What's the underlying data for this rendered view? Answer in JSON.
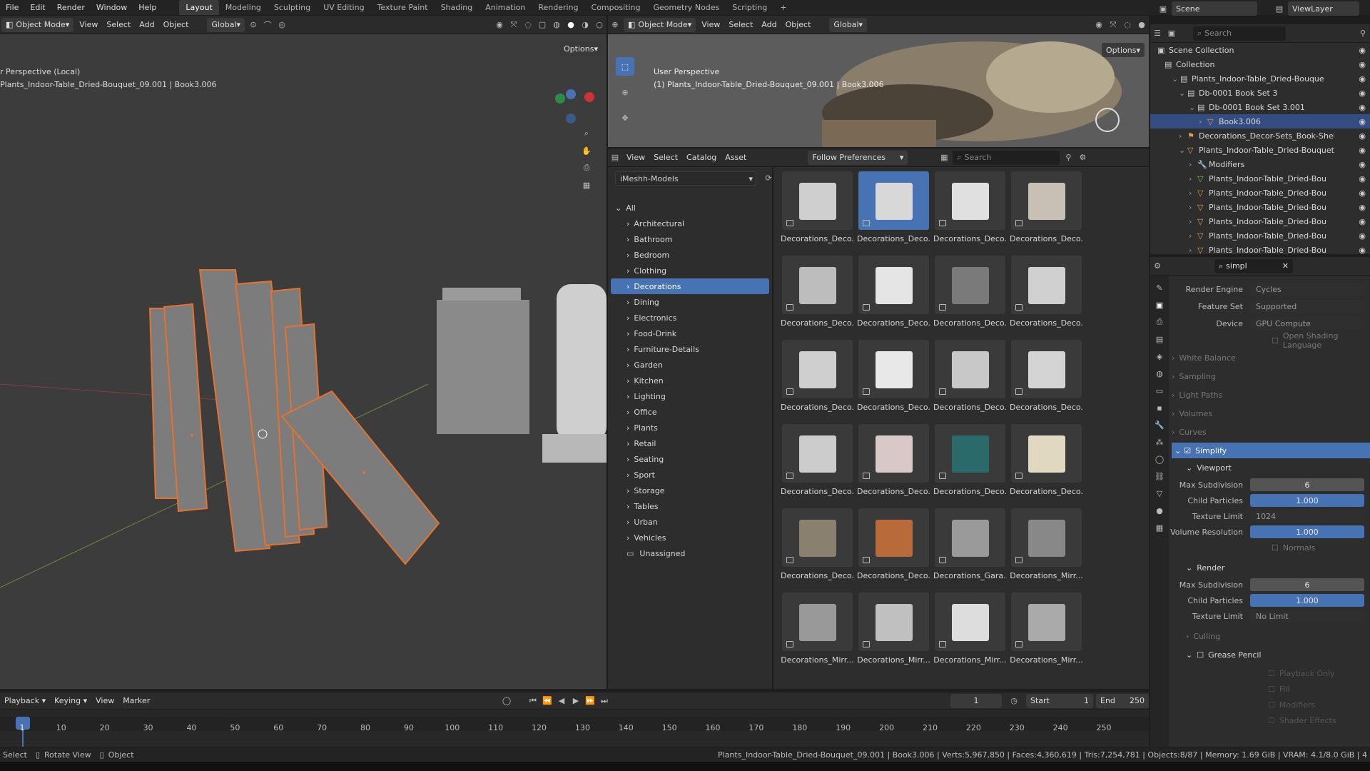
{
  "menus": [
    "File",
    "Edit",
    "Render",
    "Window",
    "Help"
  ],
  "workspaces": [
    "Layout",
    "Modeling",
    "Sculpting",
    "UV Editing",
    "Texture Paint",
    "Shading",
    "Animation",
    "Rendering",
    "Compositing",
    "Geometry Nodes",
    "Scripting",
    "+"
  ],
  "scene": "Scene",
  "view_layer": "ViewLayer",
  "vp_left": {
    "mode": "Object Mode",
    "menus": [
      "View",
      "Select",
      "Add",
      "Object"
    ],
    "orient": "Global",
    "options": "Options",
    "title": "r Perspective (Local)",
    "subtitle": "Plants_Indoor-Table_Dried-Bouquet_09.001 | Book3.006"
  },
  "vp_right": {
    "mode": "Object Mode",
    "menus": [
      "View",
      "Select",
      "Add",
      "Object"
    ],
    "orient": "Global",
    "options": "Options",
    "title": "User Perspective",
    "subtitle": "(1) Plants_Indoor-Table_Dried-Bouquet_09.001 | Book3.006"
  },
  "asset": {
    "menus": [
      "View",
      "Select",
      "Catalog",
      "Asset"
    ],
    "import": "Follow Preferences",
    "search": "Search",
    "library": "iMeshh-Models",
    "all": "All",
    "categories": [
      "Architectural",
      "Bathroom",
      "Bedroom",
      "Clothing",
      "Decorations",
      "Dining",
      "Electronics",
      "Food-Drink",
      "Furniture-Details",
      "Garden",
      "Kitchen",
      "Lighting",
      "Office",
      "Plants",
      "Retail",
      "Seating",
      "Sport",
      "Storage",
      "Tables",
      "Urban",
      "Vehicles"
    ],
    "unassigned": "Unassigned",
    "thumbs": [
      "Decorations_Deco...",
      "Decorations_Deco...",
      "Decorations_Deco...",
      "Decorations_Deco...",
      "Decorations_Deco...",
      "Decorations_Deco...",
      "Decorations_Deco...",
      "Decorations_Deco...",
      "Decorations_Deco...",
      "Decorations_Deco...",
      "Decorations_Deco...",
      "Decorations_Deco...",
      "Decorations_Deco...",
      "Decorations_Deco...",
      "Decorations_Deco...",
      "Decorations_Deco...",
      "Decorations_Deco...",
      "Decorations_Deco...",
      "Decorations_Gara...",
      "Decorations_Mirr...",
      "Decorations_Mirr...",
      "Decorations_Mirr...",
      "Decorations_Mirr...",
      "Decorations_Mirr..."
    ]
  },
  "outliner": {
    "search": "Search",
    "rows": [
      "Scene Collection",
      "Collection",
      "Plants_Indoor-Table_Dried-Bouque",
      "Db-0001 Book Set 3",
      "Db-0001 Book Set 3.001",
      "Book3.006",
      "Decorations_Decor-Sets_Book-Shelf",
      "Plants_Indoor-Table_Dried-Bouquet",
      "Modifiers",
      "Plants_Indoor-Table_Dried-Bou",
      "Plants_Indoor-Table_Dried-Bou",
      "Plants_Indoor-Table_Dried-Bou",
      "Plants_Indoor-Table_Dried-Bou",
      "Plants_Indoor-Table_Dried-Bou",
      "Plants_Indoor-Table_Dried-Bou"
    ]
  },
  "props": {
    "search": "simpl",
    "render_engine_label": "Render Engine",
    "render_engine": "Cycles",
    "feature_set_label": "Feature Set",
    "feature_set": "Supported",
    "device_label": "Device",
    "device": "GPU Compute",
    "osl": "Open Shading Language",
    "sections": [
      "White Balance",
      "Sampling",
      "Light Paths",
      "Volumes",
      "Curves"
    ],
    "simplify": "Simplify",
    "viewport": "Viewport",
    "vp_max_sub_label": "Max Subdivision",
    "vp_max_sub": "6",
    "vp_child_label": "Child Particles",
    "vp_child": "1.000",
    "vp_tex_label": "Texture Limit",
    "vp_tex": "1024",
    "vp_vol_label": "Volume Resolution",
    "vp_vol": "1.000",
    "normals": "Normals",
    "render": "Render",
    "r_max_sub_label": "Max Subdivision",
    "r_max_sub": "6",
    "r_child_label": "Child Particles",
    "r_child": "1.000",
    "r_tex_label": "Texture Limit",
    "r_tex": "No Limit",
    "culling": "Culling",
    "grease_pencil": "Grease Pencil",
    "playback_only": "Playback Only",
    "fill": "Fill",
    "modifiers": "Modifiers",
    "shader_effects": "Shader Effects"
  },
  "timeline": {
    "menus": [
      "Playback",
      "Keying",
      "View",
      "Marker"
    ],
    "current": "1",
    "start_label": "Start",
    "start": "1",
    "end_label": "End",
    "end": "250",
    "ticks": [
      "1",
      "10",
      "20",
      "30",
      "40",
      "50",
      "60",
      "70",
      "80",
      "90",
      "100",
      "110",
      "120",
      "130",
      "140",
      "150",
      "160",
      "170",
      "180",
      "190",
      "200",
      "210",
      "220",
      "230",
      "240",
      "250"
    ]
  },
  "status": {
    "select": "Select",
    "rotate": "Rotate View",
    "object": "Object",
    "info": "Plants_Indoor-Table_Dried-Bouquet_09.001 | Book3.006 | Verts:5,967,850 | Faces:4,360,619 | Tris:7,254,781 | Objects:8/87 | Memory: 1.69 GiB | VRAM: 4.1/8.0 GiB | 4"
  },
  "colors": {
    "accent": "#4772b3",
    "selection": "#e8712c",
    "viewport": "#3c3c3c"
  }
}
